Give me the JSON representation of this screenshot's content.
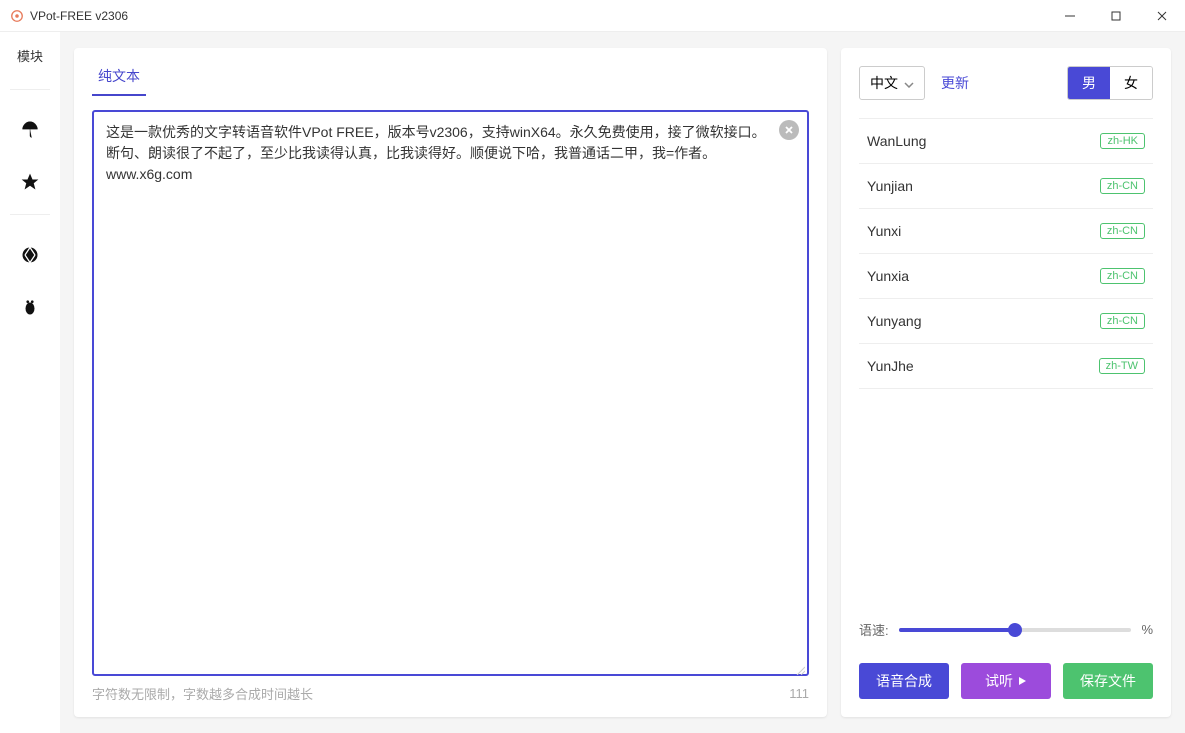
{
  "window": {
    "title": "VPot-FREE v2306"
  },
  "sidebar": {
    "label": "模块"
  },
  "tabs": {
    "plainText": "纯文本"
  },
  "editor": {
    "text": "这是一款优秀的文字转语音软件VPot FREE，版本号v2306，支持winX64。永久免费使用，接了微软接口。断句、朗读很了不起了，至少比我读得认真，比我读得好。顺便说下哈，我普通话二甲，我=作者。www.x6g.com",
    "hint": "字符数无限制，字数越多合成时间越长",
    "count": "111"
  },
  "controls": {
    "languageLabel": "中文",
    "updateLabel": "更新",
    "genderMale": "男",
    "genderFemale": "女"
  },
  "voices": [
    {
      "name": "WanLung",
      "locale": "zh-HK"
    },
    {
      "name": "Yunjian",
      "locale": "zh-CN"
    },
    {
      "name": "Yunxi",
      "locale": "zh-CN"
    },
    {
      "name": "Yunxia",
      "locale": "zh-CN"
    },
    {
      "name": "Yunyang",
      "locale": "zh-CN"
    },
    {
      "name": "YunJhe",
      "locale": "zh-TW"
    }
  ],
  "speed": {
    "label": "语速:",
    "unit": "%"
  },
  "actions": {
    "compose": "语音合成",
    "preview": "试听",
    "save": "保存文件"
  }
}
